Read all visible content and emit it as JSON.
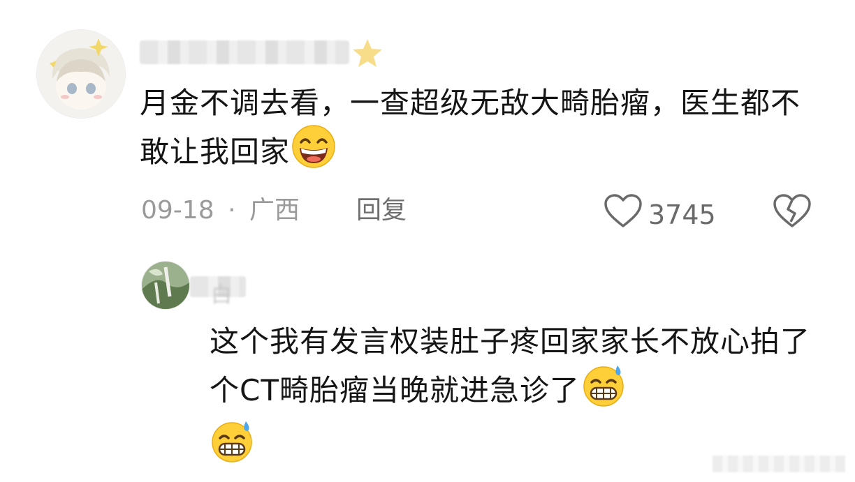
{
  "comments": [
    {
      "text": "月金不调去看，一查超级无敌大畸胎瘤，医生都不敢让我回家",
      "date": "09-18",
      "separator": "·",
      "location": "广西",
      "reply_label": "回复",
      "likes": "3745"
    },
    {
      "username_partial": "白",
      "text": "这个我有发言权装肚子疼回家家长不放心拍了个CT畸胎瘤当晚就进急诊了"
    }
  ],
  "icons": {
    "heart": "heart-outline-icon",
    "dislike": "broken-heart-icon",
    "emoji_grin": "grinning-emoji-icon",
    "emoji_sweat": "grinning-sweat-emoji-icon"
  },
  "colors": {
    "text": "#151515",
    "meta": "#9a9a9a",
    "action": "#6f6f6f"
  }
}
